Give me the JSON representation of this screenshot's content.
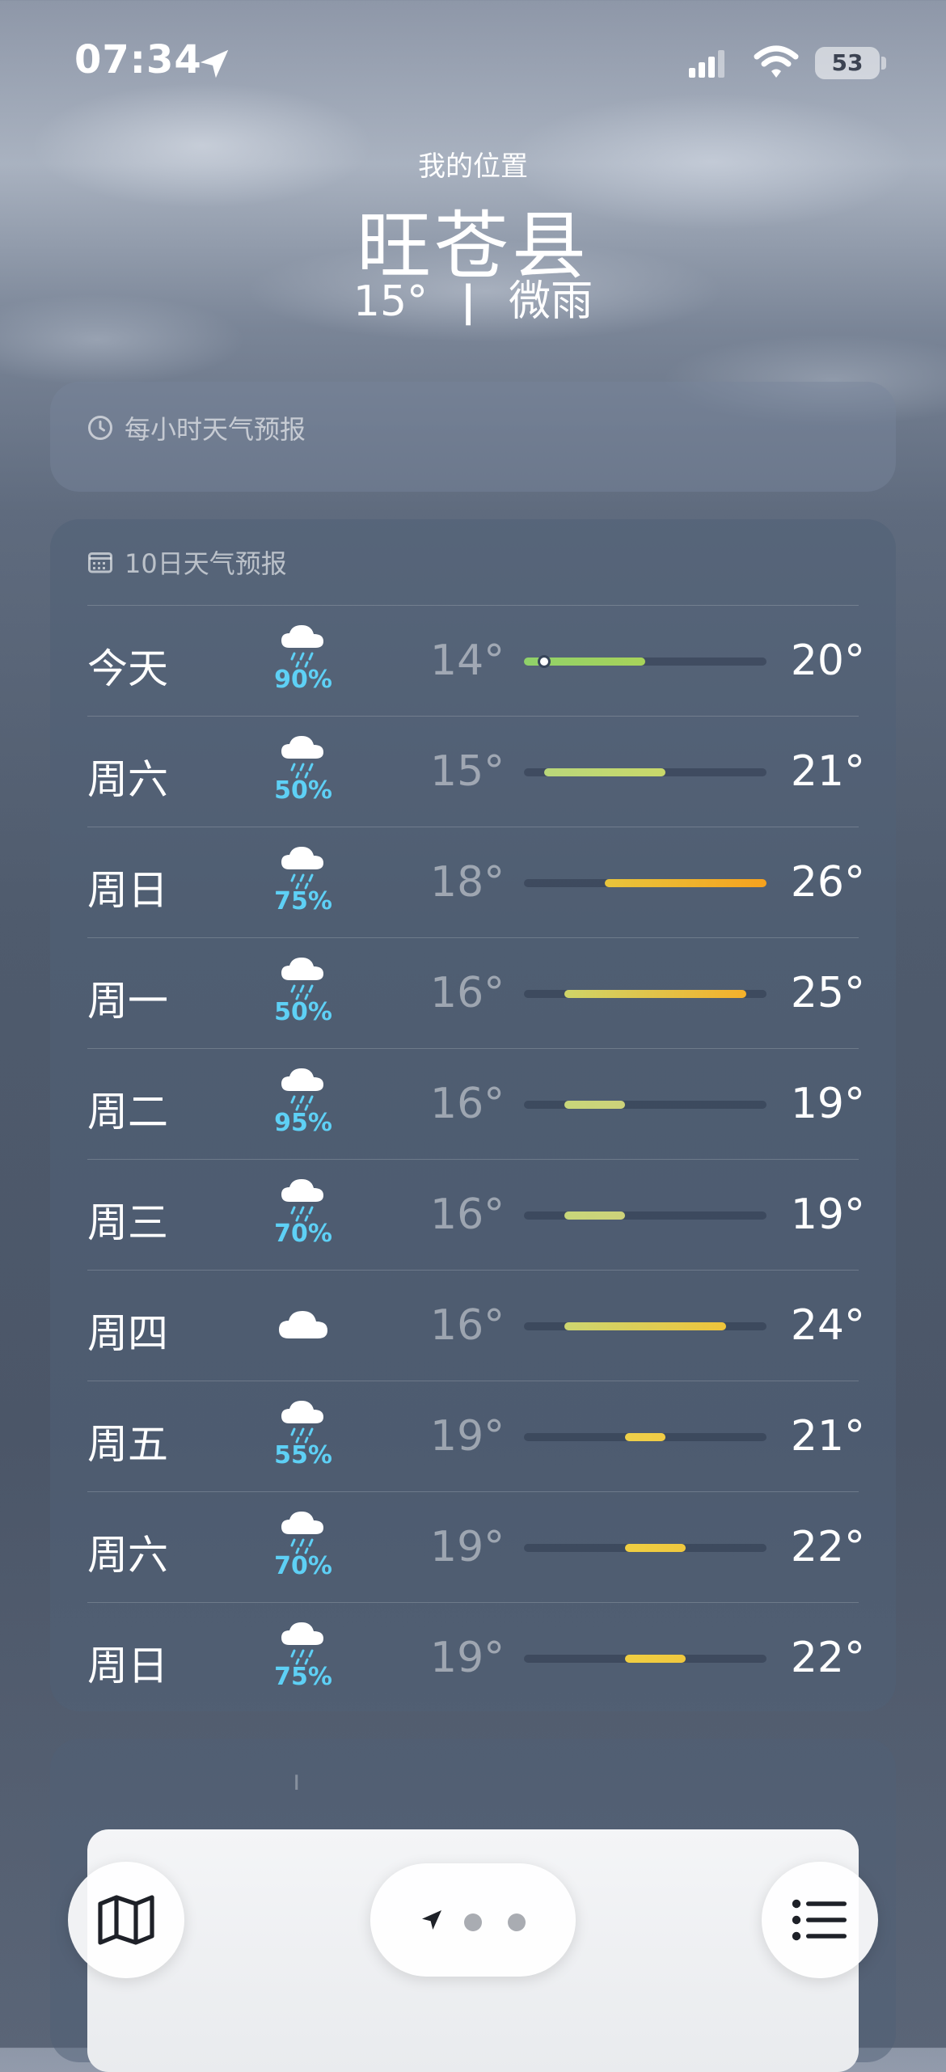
{
  "status_bar": {
    "time": "07:34",
    "battery": "53"
  },
  "header": {
    "my_location": "我的位置",
    "city": "旺苍县",
    "current_temp": "15°",
    "separator": "|",
    "condition": "微雨"
  },
  "hourly_card": {
    "title": "每小时天气预报"
  },
  "ten_day_card": {
    "title": "10日天气预报",
    "range_min": 14,
    "range_max": 26,
    "current_temp_value": 15,
    "days": [
      {
        "day": "今天",
        "icon": "rain-cloud-icon",
        "precip": "90%",
        "low": "14°",
        "high": "20°",
        "lo_v": 14,
        "hi_v": 20,
        "show_now": true,
        "color_from": "#8fd16a",
        "color_to": "#a8d35a"
      },
      {
        "day": "周六",
        "icon": "rain-cloud-icon",
        "precip": "50%",
        "low": "15°",
        "high": "21°",
        "lo_v": 15,
        "hi_v": 21,
        "color_from": "#b9d77a",
        "color_to": "#c9d86a"
      },
      {
        "day": "周日",
        "icon": "rain-cloud-icon",
        "precip": "75%",
        "low": "18°",
        "high": "26°",
        "lo_v": 18,
        "hi_v": 26,
        "color_from": "#e8c53c",
        "color_to": "#f6a21e"
      },
      {
        "day": "周一",
        "icon": "rain-cloud-icon",
        "precip": "50%",
        "low": "16°",
        "high": "25°",
        "lo_v": 16,
        "hi_v": 25,
        "color_from": "#cfd568",
        "color_to": "#f5b12a"
      },
      {
        "day": "周二",
        "icon": "rain-cloud-icon",
        "precip": "95%",
        "low": "16°",
        "high": "19°",
        "lo_v": 16,
        "hi_v": 19,
        "color_from": "#c8d67a",
        "color_to": "#cdd27a"
      },
      {
        "day": "周三",
        "icon": "rain-cloud-icon",
        "precip": "70%",
        "low": "16°",
        "high": "19°",
        "lo_v": 16,
        "hi_v": 19,
        "color_from": "#c8d67a",
        "color_to": "#cdd27a"
      },
      {
        "day": "周四",
        "icon": "cloud-icon",
        "precip": "",
        "low": "16°",
        "high": "24°",
        "lo_v": 16,
        "hi_v": 24,
        "color_from": "#cdd670",
        "color_to": "#efc43a"
      },
      {
        "day": "周五",
        "icon": "rain-cloud-icon",
        "precip": "55%",
        "low": "19°",
        "high": "21°",
        "lo_v": 19,
        "hi_v": 21,
        "color_from": "#eed04a",
        "color_to": "#f1cc45"
      },
      {
        "day": "周六",
        "icon": "rain-cloud-icon",
        "precip": "70%",
        "low": "19°",
        "high": "22°",
        "lo_v": 19,
        "hi_v": 22,
        "color_from": "#f0cf42",
        "color_to": "#f0c83e"
      },
      {
        "day": "周日",
        "icon": "rain-cloud-icon",
        "precip": "75%",
        "low": "19°",
        "high": "22°",
        "lo_v": 19,
        "hi_v": 22,
        "color_from": "#f0cf42",
        "color_to": "#f0c83e"
      }
    ]
  },
  "toolbar": {
    "map_icon": "map-icon",
    "list_icon": "list-icon",
    "pager_icons": [
      "location-arrow-icon",
      "page-dot",
      "page-dot"
    ]
  }
}
